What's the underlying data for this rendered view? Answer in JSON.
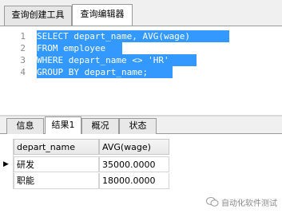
{
  "top_tabs": [
    "查询创建工具",
    "查询编辑器"
  ],
  "editor": {
    "line_numbers": [
      "1",
      "2",
      "3",
      "4"
    ],
    "lines": [
      "SELECT depart_name, AVG(wage)",
      "FROM employee",
      "WHERE depart_name <> 'HR'",
      "GROUP BY depart_name;"
    ],
    "selection_color": "#3399ff"
  },
  "bottom_tabs": [
    "信息",
    "结果1",
    "概况",
    "状态"
  ],
  "results": {
    "columns": [
      "depart_name",
      "AVG(wage)"
    ],
    "rows": [
      [
        "研发",
        "35000.0000"
      ],
      [
        "职能",
        "18000.0000"
      ]
    ],
    "current_row_marker": "▶"
  },
  "watermark": "自动化软件测试"
}
